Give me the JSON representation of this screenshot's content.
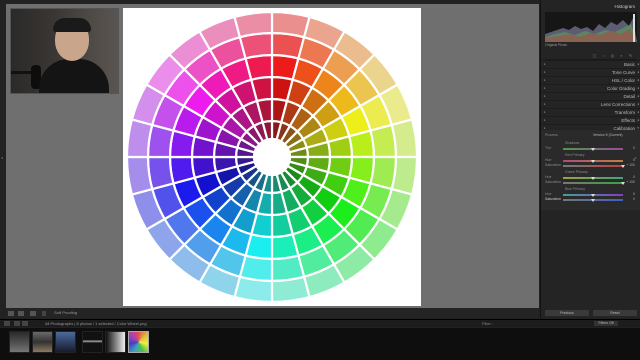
{
  "histogram": {
    "title": "Histogram",
    "caption": "Original Photo"
  },
  "tools": [
    "crop-icon",
    "spot-icon",
    "redeye-icon",
    "mask-icon",
    "brush-icon"
  ],
  "panels": [
    {
      "label": "Basic"
    },
    {
      "label": "Tone Curve"
    },
    {
      "label": "HSL / Color"
    },
    {
      "label": "Color Grading"
    },
    {
      "label": "Detail"
    },
    {
      "label": "Lens Corrections"
    },
    {
      "label": "Transform"
    },
    {
      "label": "Effects"
    },
    {
      "label": "Calibration"
    }
  ],
  "calibration": {
    "process_label": "Process",
    "process_value": "Version 5 (Current)",
    "shadows_label": "Shadows",
    "tint_label": "Tint",
    "tint_value": "0",
    "red_label": "Red Primary",
    "red_hue_label": "Hue",
    "red_hue_value": "0",
    "red_sat_label": "Saturation",
    "red_sat_value": "+ 100",
    "green_label": "Green Primary",
    "green_hue_label": "Hue",
    "green_hue_value": "0",
    "green_sat_label": "Saturation",
    "green_sat_value": "+ 100",
    "blue_label": "Blue Primary",
    "blue_hue_label": "Hue",
    "blue_hue_value": "0",
    "blue_sat_label": "Saturation",
    "blue_sat_value": "0"
  },
  "right_buttons": {
    "previous": "Previous",
    "reset": "Reset"
  },
  "toolbar": {
    "soft_proofing": "Soft Proofing"
  },
  "filmstrip": {
    "breadcrumb": "All Photographs  |  8 photos / 1 selected / Color Wheel.png",
    "filter_label": "Filter :",
    "filter_value": "Filters Off"
  },
  "colors": {
    "canvas_bg": "#6f6f6f",
    "panel_bg": "#242424"
  }
}
